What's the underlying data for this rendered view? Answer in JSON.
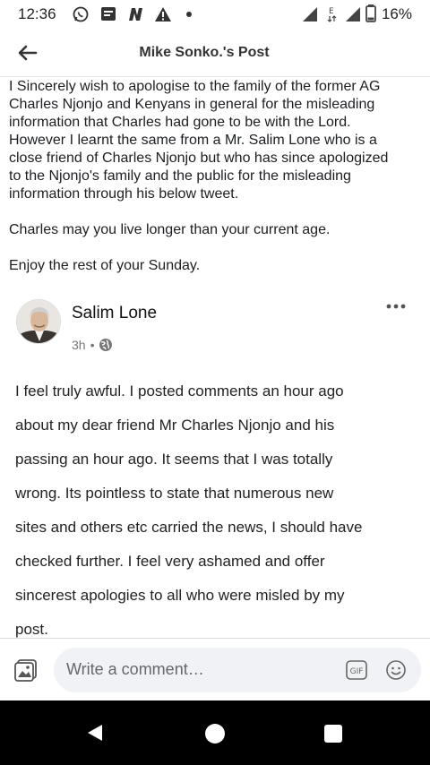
{
  "status_bar": {
    "time": "12:36",
    "battery": "16%",
    "icons": [
      "whatsapp-icon",
      "message-icon",
      "news-icon",
      "warning-icon",
      "dot-icon",
      "signal-icon",
      "signal-icon",
      "battery-icon"
    ]
  },
  "header": {
    "title": "Mike Sonko.'s Post"
  },
  "post": {
    "paragraphs": [
      "I Sincerely wish to apologise to the family of the former AG\nCharles Njonjo and Kenyans in general for the misleading\ninformation that Charles had gone to be with the Lord.\nHowever I learnt the same from a Mr. Salim Lone who is a\nclose friend of Charles Njonjo but who has since apologized\nto the Njonjo's family and the public for the misleading\ninformation through his below tweet.",
      "Charles may you live longer than your current age.",
      "Enjoy the rest of your Sunday."
    ]
  },
  "shared": {
    "author": "Salim Lone",
    "time": "3h",
    "separator": "•",
    "text": "I feel truly awful. I posted comments an hour ago\nabout my dear friend Mr Charles Njonjo and his\npassing an hour ago.  It seems that I was totally\nwrong. Its pointless to state that numerous new\nsites and others etc carried the news, I should have\nchecked further. I feel very ashamed and offer\nsincerest apologies to all who were misled by my\npost."
  },
  "composer": {
    "placeholder": "Write a comment…",
    "gif_label": "GIF"
  }
}
